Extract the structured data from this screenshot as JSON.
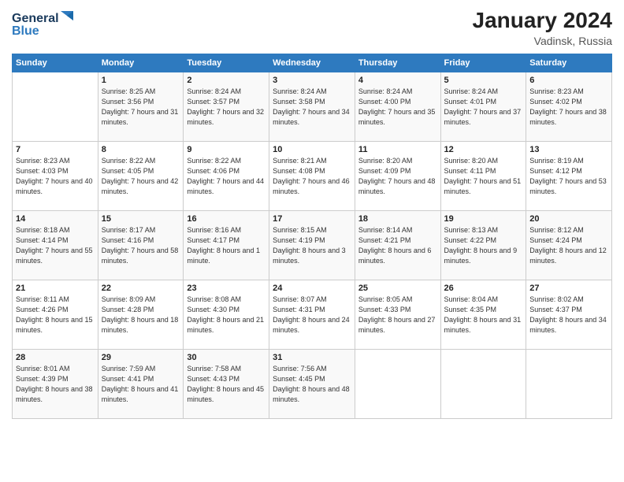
{
  "logo": {
    "line1": "General",
    "line2": "Blue"
  },
  "header": {
    "month": "January 2024",
    "location": "Vadinsk, Russia"
  },
  "weekdays": [
    "Sunday",
    "Monday",
    "Tuesday",
    "Wednesday",
    "Thursday",
    "Friday",
    "Saturday"
  ],
  "weeks": [
    [
      {
        "day": "",
        "sunrise": "",
        "sunset": "",
        "daylight": ""
      },
      {
        "day": "1",
        "sunrise": "Sunrise: 8:25 AM",
        "sunset": "Sunset: 3:56 PM",
        "daylight": "Daylight: 7 hours and 31 minutes."
      },
      {
        "day": "2",
        "sunrise": "Sunrise: 8:24 AM",
        "sunset": "Sunset: 3:57 PM",
        "daylight": "Daylight: 7 hours and 32 minutes."
      },
      {
        "day": "3",
        "sunrise": "Sunrise: 8:24 AM",
        "sunset": "Sunset: 3:58 PM",
        "daylight": "Daylight: 7 hours and 34 minutes."
      },
      {
        "day": "4",
        "sunrise": "Sunrise: 8:24 AM",
        "sunset": "Sunset: 4:00 PM",
        "daylight": "Daylight: 7 hours and 35 minutes."
      },
      {
        "day": "5",
        "sunrise": "Sunrise: 8:24 AM",
        "sunset": "Sunset: 4:01 PM",
        "daylight": "Daylight: 7 hours and 37 minutes."
      },
      {
        "day": "6",
        "sunrise": "Sunrise: 8:23 AM",
        "sunset": "Sunset: 4:02 PM",
        "daylight": "Daylight: 7 hours and 38 minutes."
      }
    ],
    [
      {
        "day": "7",
        "sunrise": "Sunrise: 8:23 AM",
        "sunset": "Sunset: 4:03 PM",
        "daylight": "Daylight: 7 hours and 40 minutes."
      },
      {
        "day": "8",
        "sunrise": "Sunrise: 8:22 AM",
        "sunset": "Sunset: 4:05 PM",
        "daylight": "Daylight: 7 hours and 42 minutes."
      },
      {
        "day": "9",
        "sunrise": "Sunrise: 8:22 AM",
        "sunset": "Sunset: 4:06 PM",
        "daylight": "Daylight: 7 hours and 44 minutes."
      },
      {
        "day": "10",
        "sunrise": "Sunrise: 8:21 AM",
        "sunset": "Sunset: 4:08 PM",
        "daylight": "Daylight: 7 hours and 46 minutes."
      },
      {
        "day": "11",
        "sunrise": "Sunrise: 8:20 AM",
        "sunset": "Sunset: 4:09 PM",
        "daylight": "Daylight: 7 hours and 48 minutes."
      },
      {
        "day": "12",
        "sunrise": "Sunrise: 8:20 AM",
        "sunset": "Sunset: 4:11 PM",
        "daylight": "Daylight: 7 hours and 51 minutes."
      },
      {
        "day": "13",
        "sunrise": "Sunrise: 8:19 AM",
        "sunset": "Sunset: 4:12 PM",
        "daylight": "Daylight: 7 hours and 53 minutes."
      }
    ],
    [
      {
        "day": "14",
        "sunrise": "Sunrise: 8:18 AM",
        "sunset": "Sunset: 4:14 PM",
        "daylight": "Daylight: 7 hours and 55 minutes."
      },
      {
        "day": "15",
        "sunrise": "Sunrise: 8:17 AM",
        "sunset": "Sunset: 4:16 PM",
        "daylight": "Daylight: 7 hours and 58 minutes."
      },
      {
        "day": "16",
        "sunrise": "Sunrise: 8:16 AM",
        "sunset": "Sunset: 4:17 PM",
        "daylight": "Daylight: 8 hours and 1 minute."
      },
      {
        "day": "17",
        "sunrise": "Sunrise: 8:15 AM",
        "sunset": "Sunset: 4:19 PM",
        "daylight": "Daylight: 8 hours and 3 minutes."
      },
      {
        "day": "18",
        "sunrise": "Sunrise: 8:14 AM",
        "sunset": "Sunset: 4:21 PM",
        "daylight": "Daylight: 8 hours and 6 minutes."
      },
      {
        "day": "19",
        "sunrise": "Sunrise: 8:13 AM",
        "sunset": "Sunset: 4:22 PM",
        "daylight": "Daylight: 8 hours and 9 minutes."
      },
      {
        "day": "20",
        "sunrise": "Sunrise: 8:12 AM",
        "sunset": "Sunset: 4:24 PM",
        "daylight": "Daylight: 8 hours and 12 minutes."
      }
    ],
    [
      {
        "day": "21",
        "sunrise": "Sunrise: 8:11 AM",
        "sunset": "Sunset: 4:26 PM",
        "daylight": "Daylight: 8 hours and 15 minutes."
      },
      {
        "day": "22",
        "sunrise": "Sunrise: 8:09 AM",
        "sunset": "Sunset: 4:28 PM",
        "daylight": "Daylight: 8 hours and 18 minutes."
      },
      {
        "day": "23",
        "sunrise": "Sunrise: 8:08 AM",
        "sunset": "Sunset: 4:30 PM",
        "daylight": "Daylight: 8 hours and 21 minutes."
      },
      {
        "day": "24",
        "sunrise": "Sunrise: 8:07 AM",
        "sunset": "Sunset: 4:31 PM",
        "daylight": "Daylight: 8 hours and 24 minutes."
      },
      {
        "day": "25",
        "sunrise": "Sunrise: 8:05 AM",
        "sunset": "Sunset: 4:33 PM",
        "daylight": "Daylight: 8 hours and 27 minutes."
      },
      {
        "day": "26",
        "sunrise": "Sunrise: 8:04 AM",
        "sunset": "Sunset: 4:35 PM",
        "daylight": "Daylight: 8 hours and 31 minutes."
      },
      {
        "day": "27",
        "sunrise": "Sunrise: 8:02 AM",
        "sunset": "Sunset: 4:37 PM",
        "daylight": "Daylight: 8 hours and 34 minutes."
      }
    ],
    [
      {
        "day": "28",
        "sunrise": "Sunrise: 8:01 AM",
        "sunset": "Sunset: 4:39 PM",
        "daylight": "Daylight: 8 hours and 38 minutes."
      },
      {
        "day": "29",
        "sunrise": "Sunrise: 7:59 AM",
        "sunset": "Sunset: 4:41 PM",
        "daylight": "Daylight: 8 hours and 41 minutes."
      },
      {
        "day": "30",
        "sunrise": "Sunrise: 7:58 AM",
        "sunset": "Sunset: 4:43 PM",
        "daylight": "Daylight: 8 hours and 45 minutes."
      },
      {
        "day": "31",
        "sunrise": "Sunrise: 7:56 AM",
        "sunset": "Sunset: 4:45 PM",
        "daylight": "Daylight: 8 hours and 48 minutes."
      },
      {
        "day": "",
        "sunrise": "",
        "sunset": "",
        "daylight": ""
      },
      {
        "day": "",
        "sunrise": "",
        "sunset": "",
        "daylight": ""
      },
      {
        "day": "",
        "sunrise": "",
        "sunset": "",
        "daylight": ""
      }
    ]
  ]
}
